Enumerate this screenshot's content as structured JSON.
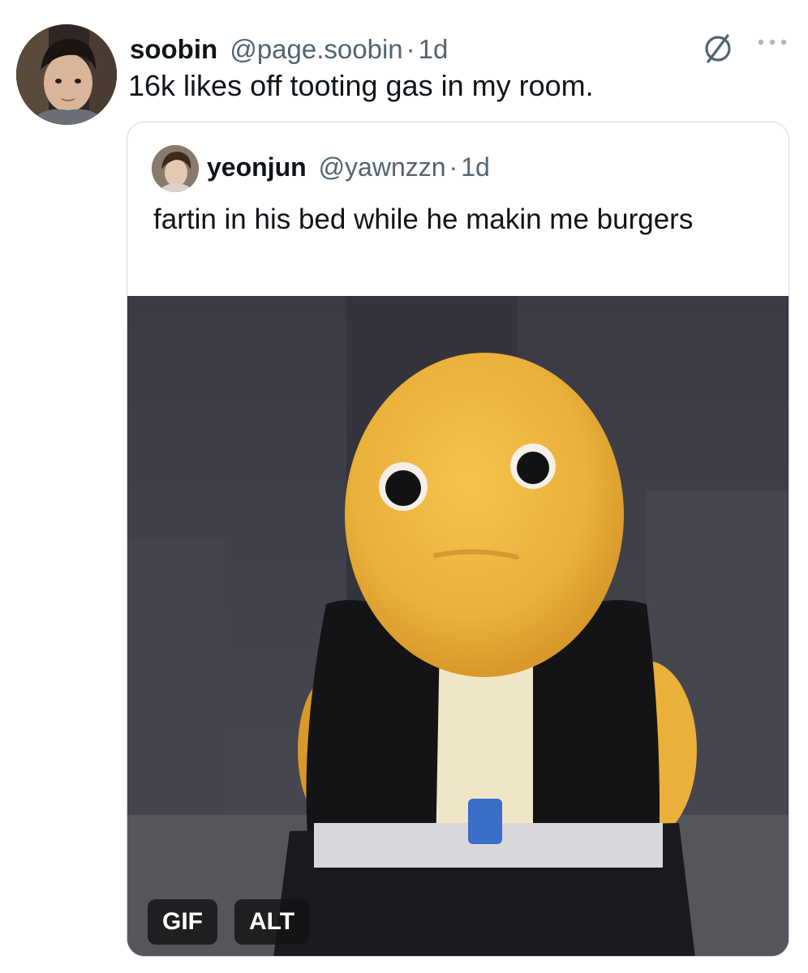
{
  "post": {
    "author": {
      "name": "soobin",
      "handle": "@page.soobin",
      "separator": "·",
      "time": "1d"
    },
    "text": "16k likes off tooting gas in my room.",
    "icons": {
      "grok": "slashed-circle-icon",
      "more": "more-dots-icon"
    }
  },
  "quote": {
    "author": {
      "name": "yeonjun",
      "handle": "@yawnzzn",
      "separator": "·",
      "time": "1d"
    },
    "text": "fartin in his bed while he makin me burgers",
    "media": {
      "gif_badge": "GIF",
      "alt_badge": "ALT"
    }
  },
  "colors": {
    "text": "#0f1419",
    "secondary": "#536471",
    "border": "#cfd9de"
  }
}
